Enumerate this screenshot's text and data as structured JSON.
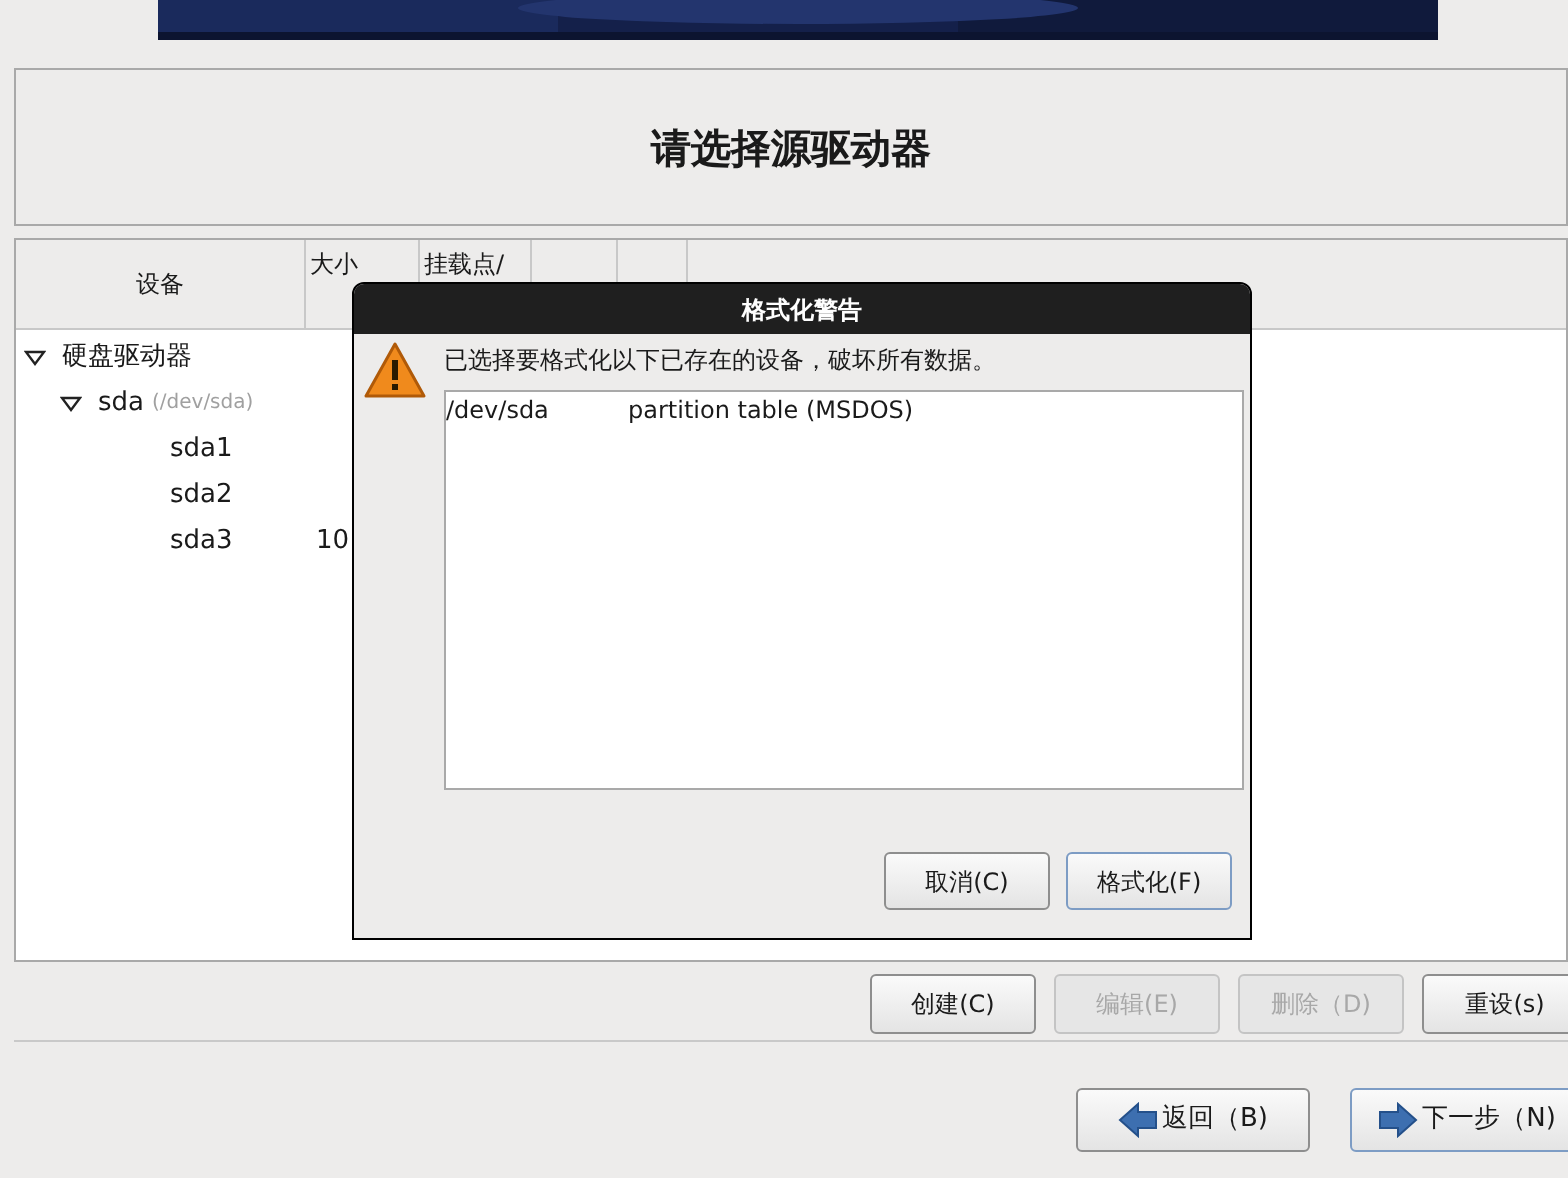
{
  "title": "请选择源驱动器",
  "table": {
    "columns": [
      "设备",
      "大小",
      "挂载点/"
    ],
    "tree": [
      {
        "label": "硬盘驱动器",
        "expanded": true,
        "children": [
          {
            "label": "sda",
            "note": "(/dev/sda)",
            "expanded": true,
            "children": [
              {
                "label": "sda1"
              },
              {
                "label": "sda2"
              },
              {
                "label": "sda3",
                "size": "10"
              }
            ]
          }
        ]
      }
    ]
  },
  "actions": [
    {
      "label": "创建(C)",
      "disabled": false
    },
    {
      "label": "编辑(E)",
      "disabled": true
    },
    {
      "label": "删除（D)",
      "disabled": true
    },
    {
      "label": "重设(s)",
      "disabled": false
    }
  ],
  "nav": [
    {
      "label": "返回（B)",
      "kind": "back"
    },
    {
      "label": "下一步（N)",
      "kind": "next"
    }
  ],
  "dialog": {
    "title": "格式化警告",
    "message": "已选择要格式化以下已存在的设备，破坏所有数据。",
    "rows": [
      {
        "device": "/dev/sda",
        "description": "partition table (MSDOS)"
      }
    ],
    "buttons": [
      {
        "label": "取消(C)",
        "default": false
      },
      {
        "label": "格式化(F)",
        "default": true
      }
    ]
  }
}
